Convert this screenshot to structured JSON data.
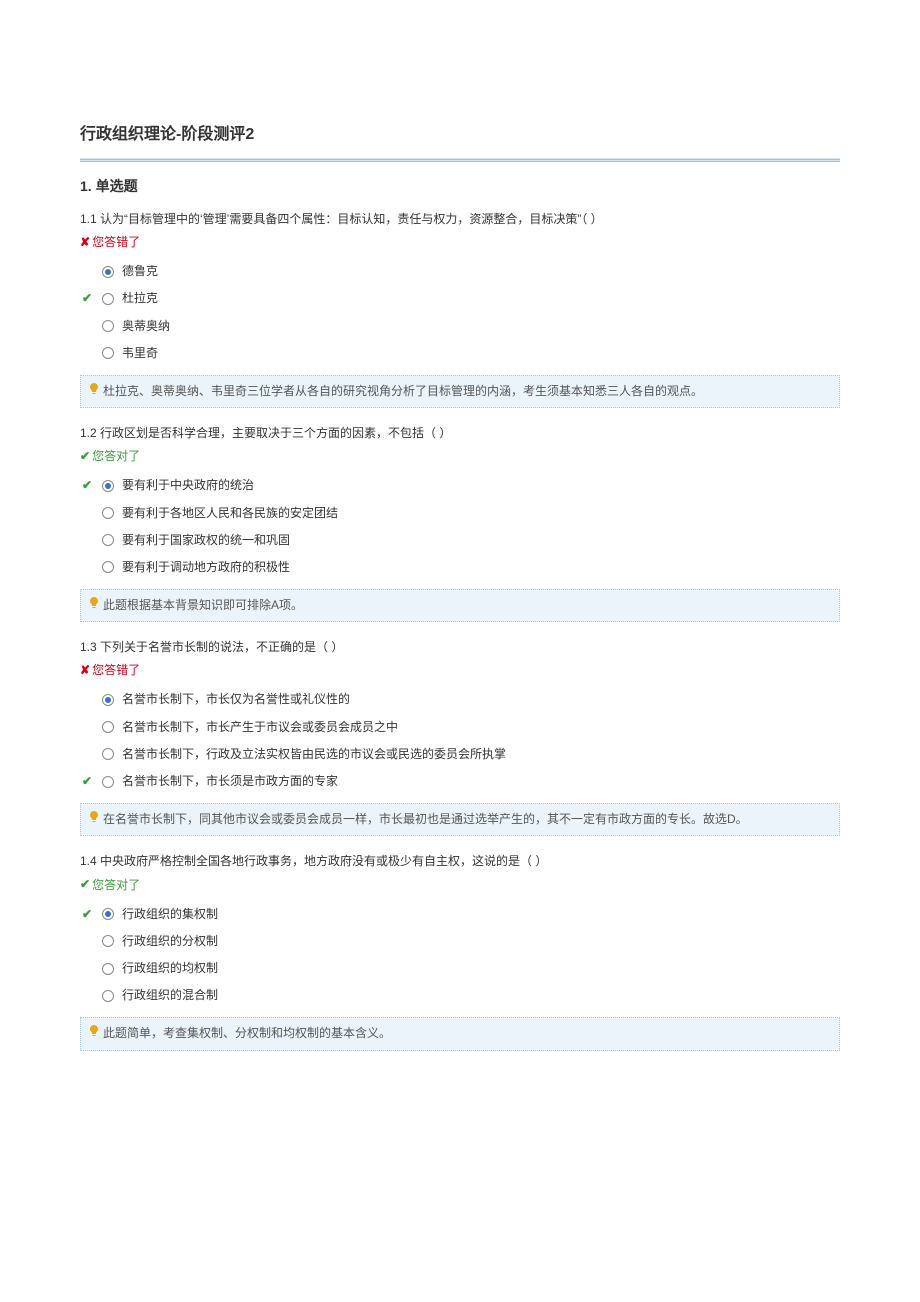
{
  "page_title": "行政组织理论-阶段测评2",
  "section_title": "1. 单选题",
  "feedback_wrong_text": "您答错了",
  "feedback_right_text": "您答对了",
  "questions": [
    {
      "num": "1.1",
      "stem": "认为“目标管理中的‘管理’需要具备四个属性：目标认知，责任与权力，资源整合，目标决策”（  ）",
      "feedback": "wrong",
      "options": [
        {
          "text": "德鲁克",
          "selected": true,
          "correct": false
        },
        {
          "text": "杜拉克",
          "selected": false,
          "correct": true
        },
        {
          "text": "奥蒂奥纳",
          "selected": false,
          "correct": false
        },
        {
          "text": "韦里奇",
          "selected": false,
          "correct": false
        }
      ],
      "hint": "杜拉克、奥蒂奥纳、韦里奇三位学者从各自的研究视角分析了目标管理的内涵，考生须基本知悉三人各自的观点。"
    },
    {
      "num": "1.2",
      "stem": "行政区划是否科学合理，主要取决于三个方面的因素，不包括（  ）",
      "feedback": "right",
      "options": [
        {
          "text": "要有利于中央政府的统治",
          "selected": true,
          "correct": true
        },
        {
          "text": "要有利于各地区人民和各民族的安定团结",
          "selected": false,
          "correct": false
        },
        {
          "text": "要有利于国家政权的统一和巩固",
          "selected": false,
          "correct": false
        },
        {
          "text": "要有利于调动地方政府的积极性",
          "selected": false,
          "correct": false
        }
      ],
      "hint": "此题根据基本背景知识即可排除A项。"
    },
    {
      "num": "1.3",
      "stem": "下列关于名誉市长制的说法，不正确的是（  ）",
      "feedback": "wrong",
      "options": [
        {
          "text": "名誉市长制下，市长仅为名誉性或礼仪性的",
          "selected": true,
          "correct": false
        },
        {
          "text": "名誉市长制下，市长产生于市议会或委员会成员之中",
          "selected": false,
          "correct": false
        },
        {
          "text": "名誉市长制下，行政及立法实权皆由民选的市议会或民选的委员会所执掌",
          "selected": false,
          "correct": false
        },
        {
          "text": "名誉市长制下，市长须是市政方面的专家",
          "selected": false,
          "correct": true
        }
      ],
      "hint": "在名誉市长制下，同其他市议会或委员会成员一样，市长最初也是通过选举产生的，其不一定有市政方面的专长。故选D。"
    },
    {
      "num": "1.4",
      "stem": "中央政府严格控制全国各地行政事务，地方政府没有或极少有自主权，这说的是（  ）",
      "feedback": "right",
      "options": [
        {
          "text": "行政组织的集权制",
          "selected": true,
          "correct": true
        },
        {
          "text": "行政组织的分权制",
          "selected": false,
          "correct": false
        },
        {
          "text": "行政组织的均权制",
          "selected": false,
          "correct": false
        },
        {
          "text": "行政组织的混合制",
          "selected": false,
          "correct": false
        }
      ],
      "hint": "此题简单，考查集权制、分权制和均权制的基本含义。"
    }
  ]
}
